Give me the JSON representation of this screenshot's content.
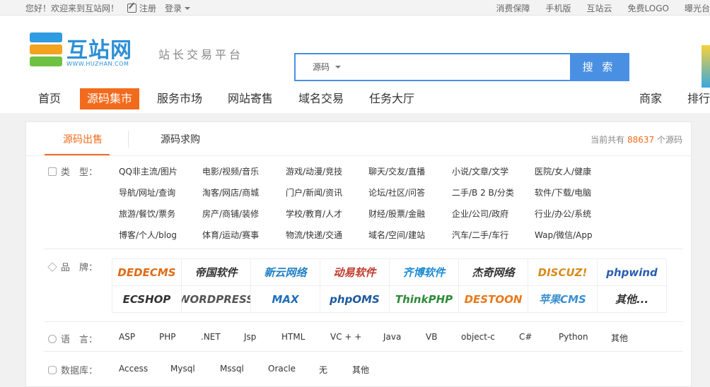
{
  "topbar": {
    "welcome": "您好！欢迎来到互站网！",
    "register": "注册",
    "login": "登录",
    "links": [
      "消费保障",
      "手机版",
      "互站云",
      "免费LOGO",
      "曝光台"
    ]
  },
  "header": {
    "logo_text": "互站网",
    "logo_url": "WWW.HUZHAN.COM",
    "slogan": "站长交易平台",
    "search": {
      "category": "源码",
      "placeholder": "",
      "button": "搜 索"
    }
  },
  "nav": {
    "items": [
      "首页",
      "源码集市",
      "服务市场",
      "网站寄售",
      "域名交易",
      "任务大厅"
    ],
    "right": [
      "商家",
      "排行"
    ]
  },
  "tabs": {
    "items": [
      "源码出售",
      "源码求购"
    ],
    "count_prefix": "当前共有 ",
    "count_value": "88637",
    "count_suffix": " 个源码"
  },
  "filters": {
    "type": {
      "label": "类　型：",
      "items": [
        "QQ非主流/图片",
        "电影/视频/音乐",
        "游戏/动漫/竞技",
        "聊天/交友/直播",
        "小说/文章/文学",
        "医院/女人/健康",
        "导航/网址/查询",
        "淘客/网店/商城",
        "门户/新闻/资讯",
        "论坛/社区/问答",
        "二手/B 2 B/分类",
        "软件/下载/电脑",
        "旅游/餐饮/票务",
        "房产/商铺/装修",
        "学校/教育/人才",
        "财经/股票/金融",
        "企业/公司/政府",
        "行业/办公/系统",
        "博客/个人/blog",
        "体育/运动/赛事",
        "物流/快递/交通",
        "域名/空间/建站",
        "汽车/二手/车行",
        "Wap/微信/App"
      ]
    },
    "brand": {
      "label": "品　牌：",
      "items": [
        {
          "name": "DEDECMS",
          "color": "#e06a12"
        },
        {
          "name": "帝国软件",
          "color": "#333333"
        },
        {
          "name": "新云网络",
          "color": "#1f7fc4"
        },
        {
          "name": "动易软件",
          "color": "#c0392b"
        },
        {
          "name": "齐博软件",
          "color": "#1b8ad3"
        },
        {
          "name": "杰奇网络",
          "color": "#333333"
        },
        {
          "name": "DISCUZ!",
          "color": "#d98a1c"
        },
        {
          "name": "phpwind",
          "color": "#2a5db0"
        },
        {
          "name": "ECSHOP",
          "color": "#333333"
        },
        {
          "name": "WORDPRESS",
          "color": "#555555"
        },
        {
          "name": "MAX",
          "color": "#1d6fb8"
        },
        {
          "name": "phpOMS",
          "color": "#1d5a9e"
        },
        {
          "name": "ThinkPHP",
          "color": "#2f8a3a"
        },
        {
          "name": "DESTOON",
          "color": "#e8781a"
        },
        {
          "name": "苹果CMS",
          "color": "#3a8fd0"
        },
        {
          "name": "其他...",
          "color": "#333333"
        }
      ]
    },
    "language": {
      "label": "语　言：",
      "items": [
        "ASP",
        "PHP",
        ".NET",
        "Jsp",
        "HTML",
        "VC + +",
        "Java",
        "VB",
        "object-c",
        "C#",
        "Python",
        "其他"
      ]
    },
    "database": {
      "label": "数据库：",
      "items": [
        "Access",
        "Mysql",
        "Mssql",
        "Oracle",
        "无",
        "其他"
      ]
    }
  }
}
